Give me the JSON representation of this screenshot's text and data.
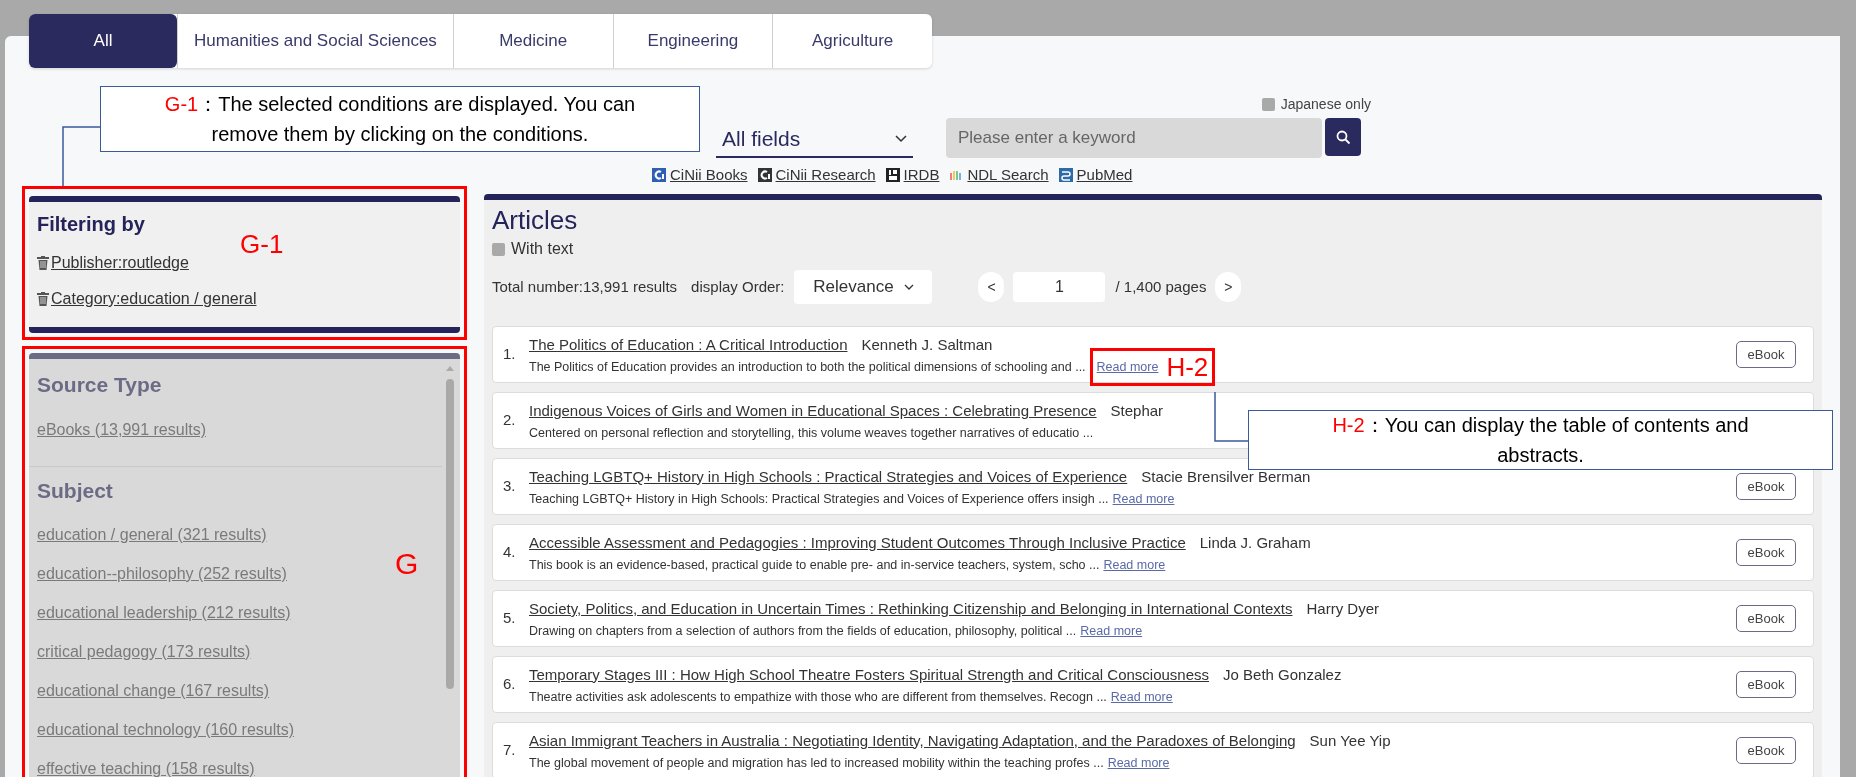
{
  "tabs": [
    {
      "label": "All",
      "selected": true
    },
    {
      "label": "Humanities and Social Sciences",
      "selected": false
    },
    {
      "label": "Medicine",
      "selected": false
    },
    {
      "label": "Engineering",
      "selected": false
    },
    {
      "label": "Agriculture",
      "selected": false
    }
  ],
  "search": {
    "japanese_only": {
      "label": "Japanese only",
      "checked": false
    },
    "field": "All fields",
    "placeholder": "Please enter a keyword"
  },
  "external_links": [
    {
      "label": "CiNii Books",
      "kind": "books"
    },
    {
      "label": "CiNii Research",
      "kind": "research"
    },
    {
      "label": "IRDB",
      "kind": "repository"
    },
    {
      "label": "NDL Search",
      "kind": "rainbow"
    },
    {
      "label": "PubMed",
      "kind": "medical"
    }
  ],
  "filters": {
    "title": "Filtering by",
    "marker": "G-1",
    "conditions": [
      "Publisher:routledge",
      "Category:education / general"
    ]
  },
  "facets": {
    "marker": "G",
    "groups": [
      {
        "title": "Source Type",
        "items": [
          "eBooks (13,991 results)"
        ]
      },
      {
        "title": "Subject",
        "items": [
          "education / general (321 results)",
          "education--philosophy (252 results)",
          "educational leadership (212 results)",
          "critical pedagogy (173 results)",
          "educational change (167 results)",
          "educational technology (160 results)",
          "effective teaching (158 results)"
        ]
      }
    ]
  },
  "articles": {
    "title": "Articles",
    "with_text": {
      "label": "With text",
      "checked": false
    },
    "total": "Total number:13,991 results",
    "order_label": "display Order:",
    "order": "Relevance",
    "prev": "<",
    "page": "1",
    "pages": "/ 1,400 pages",
    "next": ">",
    "results": [
      {
        "number": "1.",
        "title": "The Politics of Education : A Critical Introduction",
        "author": "Kenneth J. Saltman",
        "snippet": "The Politics of Education provides an introduction to both the political dimensions of schooling and ...",
        "read_more": "Read more",
        "marker": "H-2",
        "badge": "eBook"
      },
      {
        "number": "2.",
        "title": "Indigenous Voices of Girls and Women in Educational Spaces : Celebrating Presence",
        "author": "Stephar",
        "snippet": "Centered on personal reflection and storytelling, this volume weaves together narratives of educatio ..."
      },
      {
        "number": "3.",
        "title": "Teaching LGBTQ+ History in High Schools : Practical Strategies and Voices of Experience",
        "author": "Stacie Brensilver Berman",
        "snippet": "Teaching LGBTQ+ History in High Schools: Practical Strategies and Voices of Experience offers insigh ...",
        "read_more": "Read more",
        "badge": "eBook"
      },
      {
        "number": "4.",
        "title": "Accessible Assessment and Pedagogies : Improving Student Outcomes Through Inclusive Practice",
        "author": "Linda J. Graham",
        "snippet": "This book is an evidence-based, practical guide to enable pre- and in-service teachers, system, scho ...",
        "read_more": "Read more",
        "badge": "eBook"
      },
      {
        "number": "5.",
        "title": "Society, Politics, and Education in Uncertain Times : Rethinking Citizenship and Belonging in International Contexts",
        "author": "Harry Dyer",
        "snippet": "Drawing on chapters from a selection of authors from the fields of education, philosophy, political ...",
        "read_more": "Read more",
        "badge": "eBook"
      },
      {
        "number": "6.",
        "title": "Temporary Stages III : How High School Theatre Fosters Spiritual Strength and Critical Consciousness",
        "author": "Jo Beth Gonzalez",
        "snippet": "Theatre activities ask adolescents to empathize with those who are different from themselves. Recogn ...",
        "read_more": "Read more",
        "badge": "eBook"
      },
      {
        "number": "7.",
        "title": "Asian Immigrant Teachers in Australia : Negotiating Identity, Navigating Adaptation, and the Paradoxes of Belonging",
        "author": "Sun Yee Yip",
        "snippet": "The global movement of people and migration has led to increased mobility within the teaching profes ...",
        "read_more": "Read more",
        "badge": "eBook"
      }
    ]
  },
  "callouts": [
    {
      "tag": "G-1",
      "text": "：The selected conditions are displayed. You can remove them by clicking on the conditions."
    },
    {
      "tag": "H-2",
      "text": "：You can display the table of contents and abstracts."
    }
  ]
}
